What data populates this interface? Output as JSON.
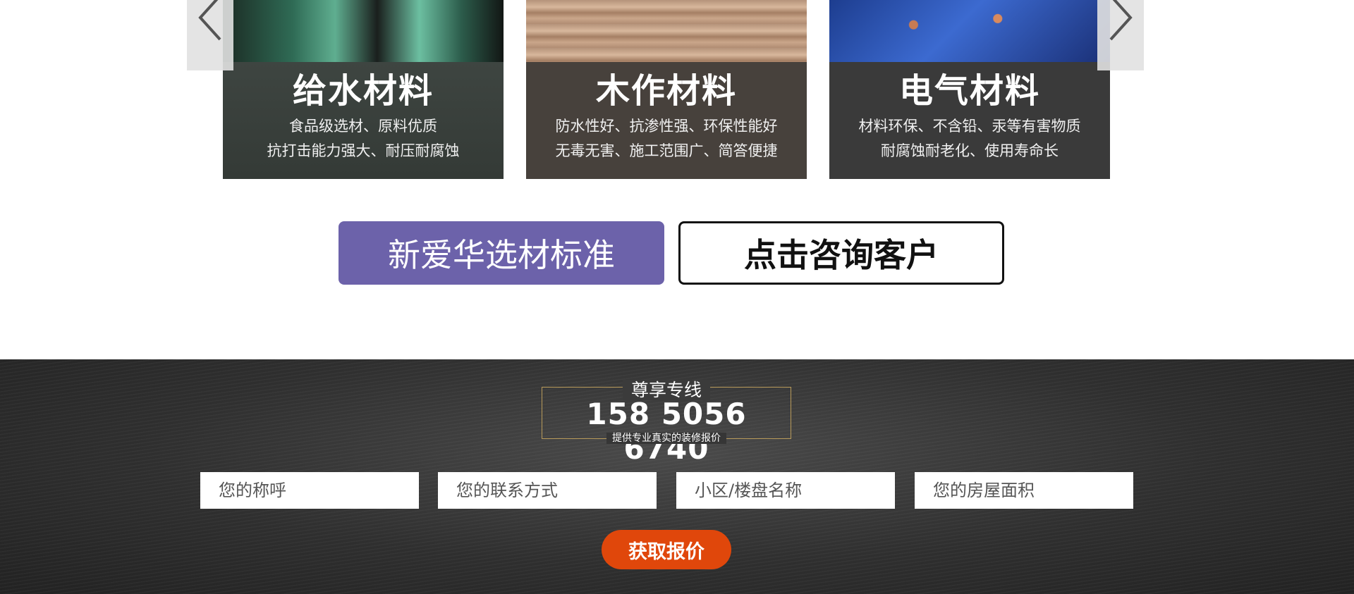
{
  "materials": {
    "cards": [
      {
        "title": "给水材料",
        "line1": "食品级选材、原料优质",
        "line2": "抗打击能力强大、耐压耐腐蚀"
      },
      {
        "title": "木作材料",
        "line1": "防水性好、抗渗性强、环保性能好",
        "line2": "无毒无害、施工范围广、简答便捷"
      },
      {
        "title": "电气材料",
        "line1": "材料环保、不含铅、汞等有害物质",
        "line2": "耐腐蚀耐老化、使用寿命长"
      }
    ]
  },
  "actions": {
    "standard_label": "新爱华选材标准",
    "consult_label": "点击咨询客户"
  },
  "hotline": {
    "label": "尊享专线",
    "phone": "158 5056 6740",
    "note": "提供专业真实的装修报价"
  },
  "form": {
    "name_placeholder": "您的称呼",
    "contact_placeholder": "您的联系方式",
    "community_placeholder": "小区/楼盘名称",
    "area_placeholder": "您的房屋面积",
    "submit_label": "获取报价"
  }
}
